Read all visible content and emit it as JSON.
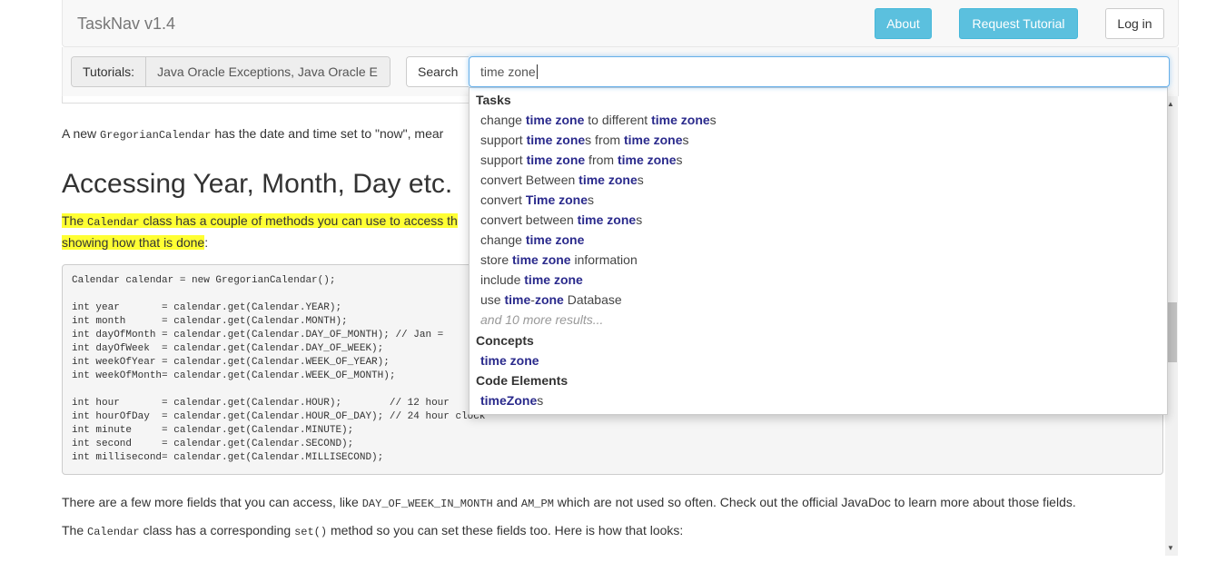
{
  "navbar": {
    "brand": "TaskNav v1.4",
    "about_label": "About",
    "request_label": "Request Tutorial",
    "login_label": "Log in"
  },
  "toolbar": {
    "tutorials_label": "Tutorials:",
    "tutorials_value": "Java Oracle Exceptions, Java Oracle E",
    "search_label": "Search",
    "search_value": "time zone"
  },
  "dropdown": {
    "tasks_header": "Tasks",
    "tasks": [
      [
        [
          "change ",
          false
        ],
        [
          "time zone",
          true
        ],
        [
          " to different ",
          false
        ],
        [
          "time zone",
          true
        ],
        [
          "s",
          false
        ]
      ],
      [
        [
          "support ",
          false
        ],
        [
          "time zone",
          true
        ],
        [
          "s from ",
          false
        ],
        [
          "time zone",
          true
        ],
        [
          "s",
          false
        ]
      ],
      [
        [
          "support ",
          false
        ],
        [
          "time zone",
          true
        ],
        [
          " from ",
          false
        ],
        [
          "time zone",
          true
        ],
        [
          "s",
          false
        ]
      ],
      [
        [
          "convert Between ",
          false
        ],
        [
          "time zone",
          true
        ],
        [
          "s",
          false
        ]
      ],
      [
        [
          "convert ",
          false
        ],
        [
          "Time zone",
          true
        ],
        [
          "s",
          false
        ]
      ],
      [
        [
          "convert between ",
          false
        ],
        [
          "time zone",
          true
        ],
        [
          "s",
          false
        ]
      ],
      [
        [
          "change ",
          false
        ],
        [
          "time zone",
          true
        ]
      ],
      [
        [
          "store ",
          false
        ],
        [
          "time zone",
          true
        ],
        [
          " information",
          false
        ]
      ],
      [
        [
          "include ",
          false
        ],
        [
          "time zone",
          true
        ]
      ],
      [
        [
          "use ",
          false
        ],
        [
          "time",
          true
        ],
        [
          "-",
          false
        ],
        [
          "zone",
          true
        ],
        [
          " Database",
          false
        ]
      ]
    ],
    "more_results": "and 10 more results...",
    "concepts_header": "Concepts",
    "concepts": [
      [
        [
          "time zone",
          true
        ]
      ]
    ],
    "code_header": "Code Elements",
    "code": [
      [
        [
          "timeZone",
          true
        ],
        [
          "s",
          false
        ]
      ]
    ]
  },
  "content": {
    "p1_pre": "A new ",
    "p1_code": "GregorianCalendar",
    "p1_post": " has the date and time set to \"now\", mear",
    "heading": "Accessing Year, Month, Day etc.",
    "hl_pre": "The ",
    "hl_code": "Calendar",
    "hl_post": " class has a couple of methods you can use to access th",
    "hl_line2": "showing how that is done",
    "hl_line2_post": ":",
    "code_block": "Calendar calendar = new GregorianCalendar();\n\nint year       = calendar.get(Calendar.YEAR);\nint month      = calendar.get(Calendar.MONTH);\nint dayOfMonth = calendar.get(Calendar.DAY_OF_MONTH); // Jan = \nint dayOfWeek  = calendar.get(Calendar.DAY_OF_WEEK);\nint weekOfYear = calendar.get(Calendar.WEEK_OF_YEAR);\nint weekOfMonth= calendar.get(Calendar.WEEK_OF_MONTH);\n\nint hour       = calendar.get(Calendar.HOUR);        // 12 hour\nint hourOfDay  = calendar.get(Calendar.HOUR_OF_DAY); // 24 hour clock\nint minute     = calendar.get(Calendar.MINUTE);\nint second     = calendar.get(Calendar.SECOND);\nint millisecond= calendar.get(Calendar.MILLISECOND);",
    "p2_pre": "There are a few more fields that you can access, like ",
    "p2_code1": "DAY_OF_WEEK_IN_MONTH",
    "p2_mid": " and ",
    "p2_code2": "AM_PM",
    "p2_post": " which are not used so often. Check out the official JavaDoc to learn more about those fields.",
    "p3_pre": "The ",
    "p3_code1": "Calendar",
    "p3_mid": " class has a corresponding ",
    "p3_code2": "set()",
    "p3_post": " method so you can set these fields too. Here is how that looks:"
  }
}
